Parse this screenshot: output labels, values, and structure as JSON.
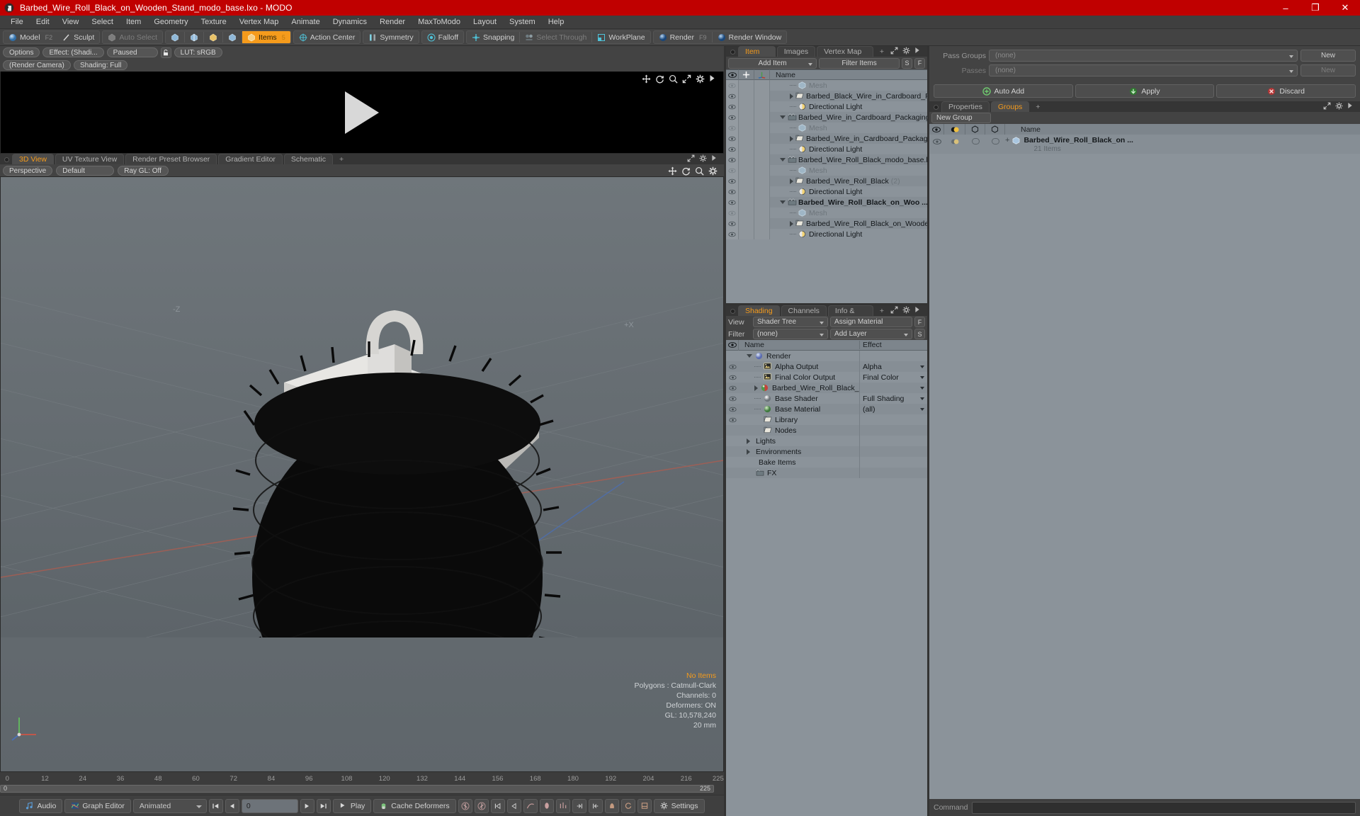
{
  "titlebar": {
    "title": "Barbed_Wire_Roll_Black_on_Wooden_Stand_modo_base.lxo - MODO",
    "minimize": "–",
    "maximize": "❐",
    "close": "✕"
  },
  "menubar": {
    "items": [
      "File",
      "Edit",
      "View",
      "Select",
      "Item",
      "Geometry",
      "Texture",
      "Vertex Map",
      "Animate",
      "Dynamics",
      "Render",
      "MaxToModo",
      "Layout",
      "System",
      "Help"
    ]
  },
  "toolbar": {
    "model": "Model",
    "model_key": "F2",
    "sculpt": "Sculpt",
    "auto_select": "Auto Select",
    "items": "Items",
    "items_key": "5",
    "action_center": "Action Center",
    "symmetry": "Symmetry",
    "falloff": "Falloff",
    "snapping": "Snapping",
    "select_through": "Select Through",
    "workplane": "WorkPlane",
    "render": "Render",
    "render_key": "F9",
    "render_window": "Render Window"
  },
  "render_preview": {
    "tabs": [],
    "options": "Options",
    "effect": "Effect: (Shadi...",
    "paused": "Paused",
    "lut": "LUT: sRGB",
    "camera": "(Render Camera)",
    "shading": "Shading: Full"
  },
  "viewport": {
    "tabs": [
      {
        "label": "3D View",
        "selected": true
      },
      {
        "label": "UV Texture View",
        "selected": false
      },
      {
        "label": "Render Preset Browser",
        "selected": false
      },
      {
        "label": "Gradient Editor",
        "selected": false
      },
      {
        "label": "Schematic",
        "selected": false
      },
      {
        "label": "+",
        "selected": false
      }
    ],
    "perspective": "Perspective",
    "default": "Default",
    "raygl": "Ray GL: Off",
    "info": {
      "no_items": "No Items",
      "polygons": "Polygons : Catmull-Clark",
      "channels": "Channels: 0",
      "deformers": "Deformers: ON",
      "gl": "GL: 10,578,240",
      "unit": "20 mm"
    },
    "axis_labels": {
      "x": "+X",
      "z": "-Z"
    }
  },
  "timeline": {
    "ticks": [
      "0",
      "12",
      "24",
      "36",
      "48",
      "60",
      "72",
      "84",
      "96",
      "108",
      "120",
      "132",
      "144",
      "156",
      "168",
      "180",
      "192",
      "204",
      "216"
    ],
    "end": "225",
    "bar_start": "0",
    "bar_end": "225"
  },
  "bottombar": {
    "audio": "Audio",
    "graph_editor": "Graph Editor",
    "animated": "Animated",
    "frame": "0",
    "play": "Play",
    "cache_deformers": "Cache Deformers",
    "settings": "Settings"
  },
  "item_list": {
    "tabs": [
      {
        "label": "Item List",
        "selected": true
      },
      {
        "label": "Images",
        "selected": false
      },
      {
        "label": "Vertex Map List",
        "selected": false
      },
      {
        "label": "+",
        "selected": false
      }
    ],
    "add_item": "Add Item",
    "filter_items": "Filter Items",
    "btn_s": "S",
    "btn_f": "F",
    "col_name": "Name",
    "rows": [
      {
        "indent": 2,
        "toggle": "dot",
        "icon": "mesh",
        "label": "Mesh",
        "dim": true,
        "bold": false,
        "count": ""
      },
      {
        "indent": 2,
        "toggle": "right",
        "icon": "folder",
        "label": "Barbed_Black_Wire_in_Cardboard_Pa ...",
        "dim": false,
        "bold": false,
        "count": ""
      },
      {
        "indent": 2,
        "toggle": "dot",
        "icon": "light",
        "label": "Directional Light",
        "dim": false,
        "bold": false,
        "count": ""
      },
      {
        "indent": 1,
        "toggle": "down",
        "icon": "scene",
        "label": "Barbed_Wire_in_Cardboard_Packaging_ ...",
        "dim": false,
        "bold": false,
        "count": ""
      },
      {
        "indent": 2,
        "toggle": "dot",
        "icon": "mesh",
        "label": "Mesh",
        "dim": true,
        "bold": false,
        "count": ""
      },
      {
        "indent": 2,
        "toggle": "right",
        "icon": "folder",
        "label": "Barbed_Wire_in_Cardboard_Packagin ...",
        "dim": false,
        "bold": false,
        "count": ""
      },
      {
        "indent": 2,
        "toggle": "dot",
        "icon": "light",
        "label": "Directional Light",
        "dim": false,
        "bold": false,
        "count": ""
      },
      {
        "indent": 1,
        "toggle": "down",
        "icon": "scene",
        "label": "Barbed_Wire_Roll_Black_modo_base.lxo",
        "dim": false,
        "bold": false,
        "count": ""
      },
      {
        "indent": 2,
        "toggle": "dot",
        "icon": "mesh",
        "label": "Mesh",
        "dim": true,
        "bold": false,
        "count": ""
      },
      {
        "indent": 2,
        "toggle": "right",
        "icon": "folder",
        "label": "Barbed_Wire_Roll_Black",
        "dim": false,
        "bold": false,
        "count": "(2)"
      },
      {
        "indent": 2,
        "toggle": "dot",
        "icon": "light",
        "label": "Directional Light",
        "dim": false,
        "bold": false,
        "count": ""
      },
      {
        "indent": 1,
        "toggle": "down",
        "icon": "scene",
        "label": "Barbed_Wire_Roll_Black_on_Woo ...",
        "dim": false,
        "bold": true,
        "count": ""
      },
      {
        "indent": 2,
        "toggle": "dot",
        "icon": "mesh",
        "label": "Mesh",
        "dim": true,
        "bold": false,
        "count": ""
      },
      {
        "indent": 2,
        "toggle": "right",
        "icon": "folder",
        "label": "Barbed_Wire_Roll_Black_on_Wooden ...",
        "dim": false,
        "bold": false,
        "count": ""
      },
      {
        "indent": 2,
        "toggle": "dot",
        "icon": "light",
        "label": "Directional Light",
        "dim": false,
        "bold": false,
        "count": ""
      }
    ]
  },
  "shading": {
    "tabs": [
      {
        "label": "Shading",
        "selected": true
      },
      {
        "label": "Channels",
        "selected": false
      },
      {
        "label": "Info & Statistics",
        "selected": false
      },
      {
        "label": "+",
        "selected": false
      }
    ],
    "view_label": "View",
    "view_value": "Shader Tree",
    "assign_material": "Assign Material",
    "filter_label": "Filter",
    "filter_value": "(none)",
    "add_layer": "Add Layer",
    "btn_f": "F",
    "btn_s": "S",
    "col_name": "Name",
    "col_effect": "Effect",
    "rows": [
      {
        "indent": 1,
        "toggle": "down",
        "icon": "render",
        "label": "Render",
        "effect": "",
        "has_arrow": false
      },
      {
        "indent": 2,
        "toggle": "dot",
        "icon": "image",
        "label": "Alpha Output",
        "effect": "Alpha",
        "has_arrow": true
      },
      {
        "indent": 2,
        "toggle": "dot",
        "icon": "image",
        "label": "Final Color Output",
        "effect": "Final Color",
        "has_arrow": true
      },
      {
        "indent": 2,
        "toggle": "right",
        "icon": "material",
        "label": "Barbed_Wire_Roll_Black_o ...",
        "effect": "",
        "has_arrow": true
      },
      {
        "indent": 2,
        "toggle": "dot",
        "icon": "shader",
        "label": "Base Shader",
        "effect": "Full Shading",
        "has_arrow": true
      },
      {
        "indent": 2,
        "toggle": "dot",
        "icon": "basemat",
        "label": "Base Material",
        "effect": "(all)",
        "has_arrow": true
      },
      {
        "indent": 2,
        "toggle": "none",
        "icon": "folder",
        "label": "Library",
        "effect": "",
        "has_arrow": false
      },
      {
        "indent": 2,
        "toggle": "none",
        "icon": "folder",
        "label": "Nodes",
        "effect": "",
        "has_arrow": false
      },
      {
        "indent": 1,
        "toggle": "right",
        "icon": "none",
        "label": "Lights",
        "effect": "",
        "has_arrow": false
      },
      {
        "indent": 1,
        "toggle": "right",
        "icon": "none",
        "label": "Environments",
        "effect": "",
        "has_arrow": false
      },
      {
        "indent": 1,
        "toggle": "none",
        "icon": "none",
        "label": "Bake Items",
        "effect": "",
        "has_arrow": false
      },
      {
        "indent": 1,
        "toggle": "none",
        "icon": "fx",
        "label": "FX",
        "effect": "",
        "has_arrow": false
      }
    ]
  },
  "passes": {
    "pass_groups_label": "Pass Groups",
    "pass_groups_value": "(none)",
    "pass_groups_new": "New",
    "passes_label": "Passes",
    "passes_value": "(none)",
    "passes_new": "New",
    "auto_add": "Auto Add",
    "apply": "Apply",
    "discard": "Discard"
  },
  "groups": {
    "tabs": [
      {
        "label": "Properties",
        "selected": false
      },
      {
        "label": "Groups",
        "selected": true
      },
      {
        "label": "+",
        "selected": false
      }
    ],
    "new_group": "New Group",
    "col_name": "Name",
    "row": {
      "label": "Barbed_Wire_Roll_Black_on ...",
      "sub": "21 Items",
      "plus": "+"
    }
  },
  "command": {
    "placeholder": "Command"
  },
  "colors": {
    "title_bg": "#c00000",
    "accent": "#f59b1c",
    "panel_bg": "#434343",
    "tree_bg": "#8b939a",
    "tree_head": "#7d858c"
  }
}
